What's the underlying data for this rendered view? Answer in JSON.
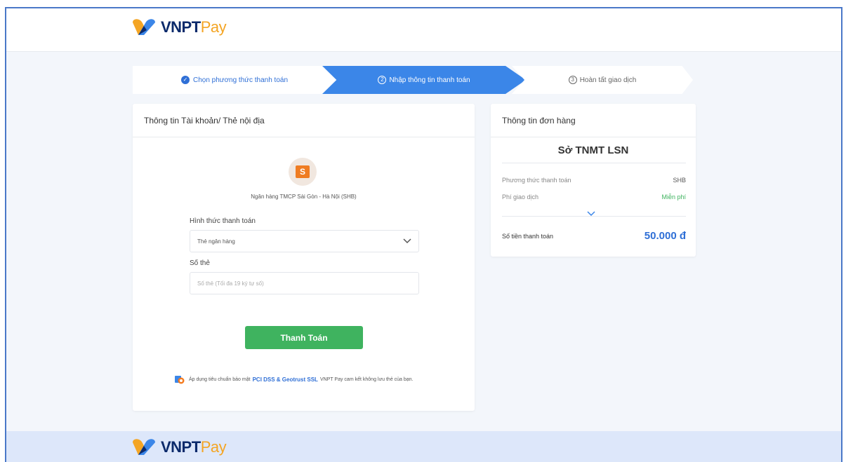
{
  "header": {
    "brand_vnpt": "VNPT",
    "brand_pay": "Pay"
  },
  "steps": [
    {
      "label": "Chọn phương thức thanh toán",
      "state": "done"
    },
    {
      "num": "2",
      "label": "Nhập thông tin thanh toán",
      "state": "active"
    },
    {
      "num": "3",
      "label": "Hoàn tất giao dịch",
      "state": "pending"
    }
  ],
  "payment_card": {
    "title": "Thông tin Tài khoản/ Thẻ nội địa",
    "bank_name": "Ngân hàng TMCP Sài Gòn - Hà Nội (SHB)",
    "method_label": "Hình thức thanh toán",
    "method_value": "Thẻ ngân hàng",
    "card_number_label": "Số thẻ",
    "card_number_placeholder": "Số thẻ (Tối đa 19 ký tự số)",
    "pay_button": "Thanh Toán",
    "security_prefix": "Áp dụng tiêu chuẩn bảo mật",
    "security_highlight": "PCI DSS & Geotrust SSL",
    "security_suffix": "VNPT Pay cam kết không lưu thẻ của bạn."
  },
  "order_card": {
    "title": "Thông tin đơn hàng",
    "merchant": "Sở TNMT LSN",
    "method_label": "Phương thức thanh toán",
    "method_value": "SHB",
    "fee_label": "Phí giao dịch",
    "fee_value": "Miễn phí",
    "total_label": "Số tiền thanh toán",
    "total_value": "50.000 đ"
  },
  "footer": {
    "brand_vnpt": "VNPT",
    "brand_pay": "Pay"
  },
  "colors": {
    "primary": "#3b86e8",
    "green": "#3fb35f",
    "brand_navy": "#0b2a6b",
    "brand_orange": "#f4a524"
  }
}
